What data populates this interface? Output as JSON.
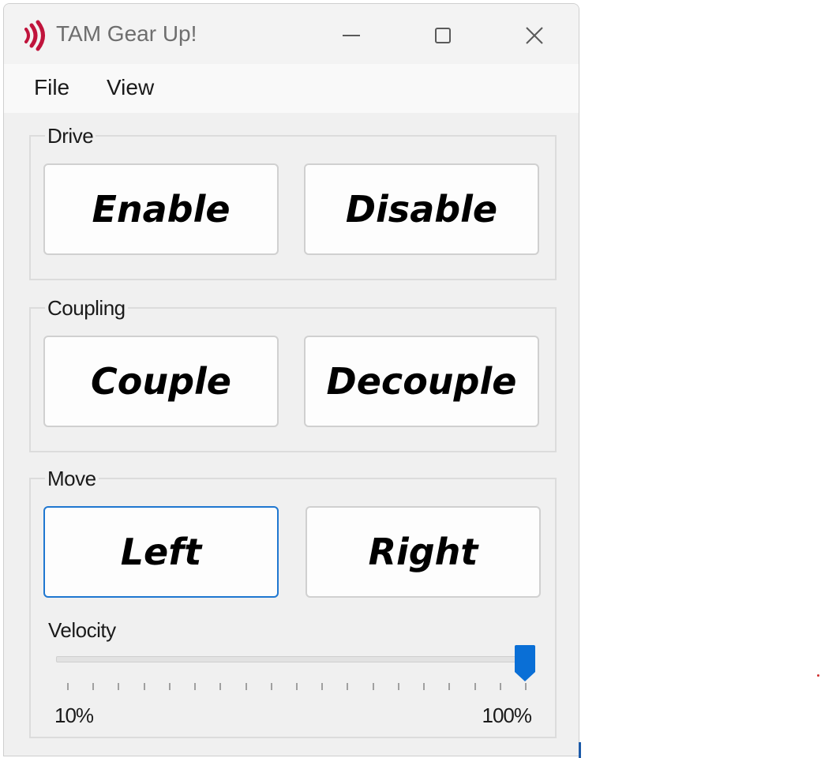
{
  "window": {
    "title": "TAM Gear Up!",
    "icon": "tam-logo-icon",
    "controls": [
      "minimize-icon",
      "maximize-icon",
      "close-icon"
    ]
  },
  "menu": {
    "file": "File",
    "view": "View"
  },
  "groups": {
    "drive": {
      "label": "Drive",
      "enable": "Enable",
      "disable": "Disable"
    },
    "coupling": {
      "label": "Coupling",
      "couple": "Couple",
      "decouple": "Decouple"
    },
    "move": {
      "label": "Move",
      "left": "Left",
      "right": "Right",
      "focused_button": "Left"
    }
  },
  "velocity": {
    "label": "Velocity",
    "min_label": "10%",
    "max_label": "100%",
    "min": 10,
    "max": 100,
    "value": 100,
    "tick_count": 19
  },
  "colors": {
    "accent": "#1f77d0",
    "thumb": "#0a6fd6",
    "logo": "#c0143c"
  }
}
